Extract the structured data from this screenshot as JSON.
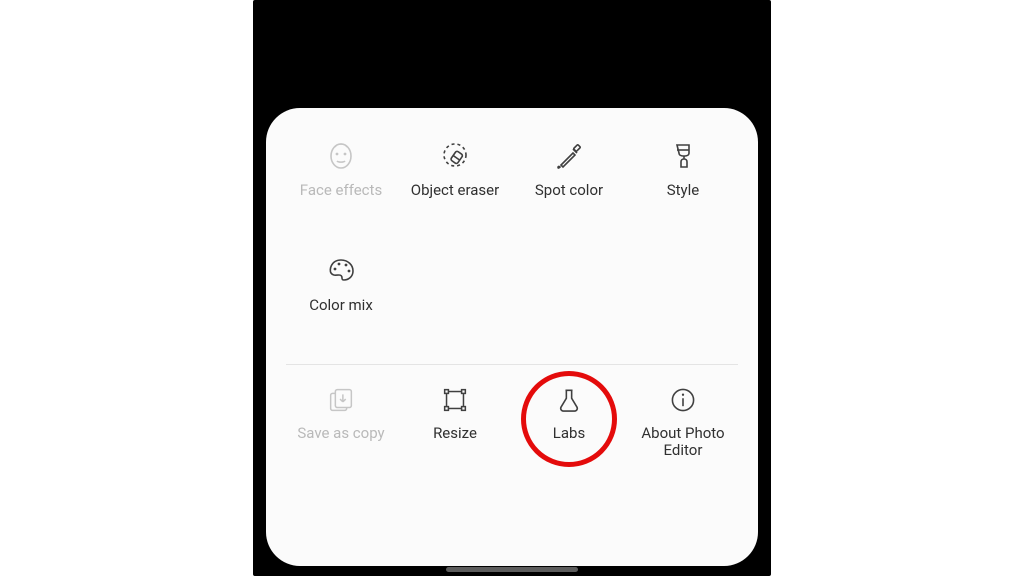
{
  "sheet": {
    "tools": [
      {
        "key": "face-effects",
        "label": "Face effects",
        "enabled": false
      },
      {
        "key": "object-eraser",
        "label": "Object eraser",
        "enabled": true
      },
      {
        "key": "spot-color",
        "label": "Spot color",
        "enabled": true
      },
      {
        "key": "style",
        "label": "Style",
        "enabled": true
      },
      {
        "key": "color-mix",
        "label": "Color mix",
        "enabled": true
      }
    ],
    "menu": [
      {
        "key": "save-as-copy",
        "label": "Save as copy",
        "enabled": false
      },
      {
        "key": "resize",
        "label": "Resize",
        "enabled": true
      },
      {
        "key": "labs",
        "label": "Labs",
        "enabled": true
      },
      {
        "key": "about",
        "label": "About Photo Editor",
        "enabled": true
      }
    ]
  },
  "annotation": {
    "highlighted_item": "labs",
    "circle_color": "#e40b0b"
  }
}
